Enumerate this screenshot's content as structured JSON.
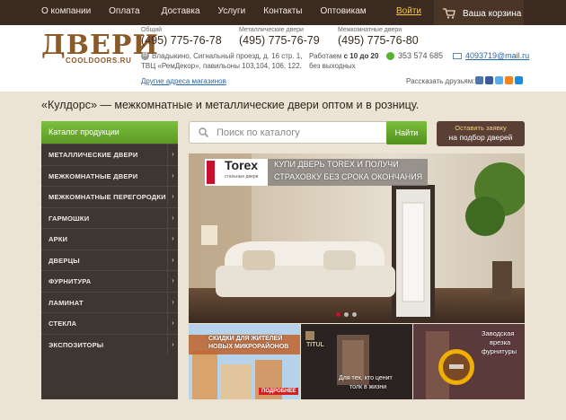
{
  "nav": {
    "items": [
      "О компании",
      "Оплата",
      "Доставка",
      "Услуги",
      "Контакты",
      "Оптовикам"
    ],
    "login": "Войти",
    "cart": "Ваша корзина"
  },
  "logo": {
    "big": "ДВЕРИ",
    "small": "COOLDOORS.RU"
  },
  "phones": [
    {
      "label": "Общий",
      "number": "(495) 775-76-78"
    },
    {
      "label": "Металлические двери",
      "number": "(495) 775-76-79"
    },
    {
      "label": "Межкомнатные двери",
      "number": "(495) 775-76-80"
    }
  ],
  "address": {
    "metro_icon": "metro-icon",
    "line1": "Владыкино, Сигнальный проезд, д. 16 стр. 1,",
    "line2": "ТВЦ «РемДекор», павильоны 103,104, 106, 122.",
    "other": "Другие адреса магазинов"
  },
  "hours": {
    "prefix": "Работаем ",
    "bold": "с 10 до 20",
    "line2": "без выходных"
  },
  "icq": "353 574 685",
  "email": "4093719@mail.ru",
  "share": "Рассказать друзьям:",
  "tagline": "«Кулдорс» — межкомнатные и металлические двери оптом и в розницу.",
  "sidebar": {
    "title": "Каталог продукции",
    "items": [
      "МЕТАЛЛИЧЕСКИЕ ДВЕРИ",
      "МЕЖКОМНАТНЫЕ ДВЕРИ",
      "МЕЖКОМНАТНЫЕ ПЕРЕГОРОДКИ",
      "ГАРМОШКИ",
      "АРКИ",
      "ДВЕРЦЫ",
      "ФУРНИТУРА",
      "ЛАМИНАТ",
      "СТЕКЛА",
      "ЭКСПОЗИТОРЫ"
    ]
  },
  "search": {
    "placeholder": "Поиск по каталогу",
    "button": "Найти"
  },
  "order": {
    "line1": "Оставить заявку",
    "line2": "на подбор дверей"
  },
  "banner": {
    "brand": "Torex",
    "brand_sub": "стальные двери",
    "line1": "КУПИ ДВЕРЬ TOREX И ПОЛУЧИ",
    "line2": "СТРАХОВКУ БЕЗ СРОКА ОКОНЧАНИЯ"
  },
  "thumbs": [
    {
      "line1": "СКИДКИ ДЛЯ ЖИТЕЛЕЙ",
      "line2": "НОВЫХ МИКРОРАЙОНОВ",
      "tag": "ПОДРОБНЕЕ"
    },
    {
      "brand": "TITUL",
      "line1": "Для тех, кто ценит",
      "line2": "толк в жизни"
    },
    {
      "line1": "Заводская",
      "line2": "врезка",
      "line3": "фурнитуры"
    }
  ]
}
